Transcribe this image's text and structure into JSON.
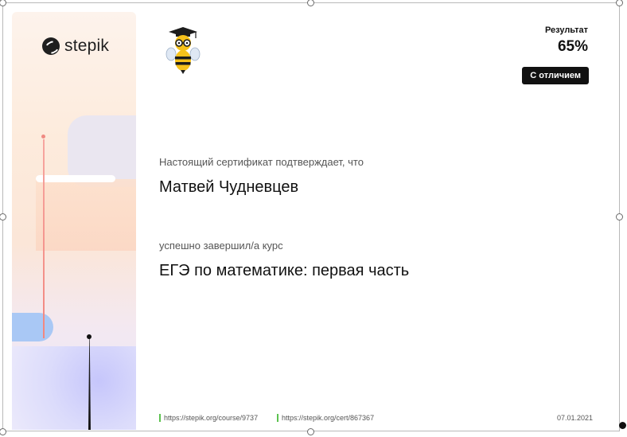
{
  "certificate": {
    "brand": "stepik",
    "result_label": "Результат",
    "result_value": "65%",
    "badge": "С отличием",
    "confirm_text": "Настоящий сертификат подтверждает, что",
    "recipient_name": "Матвей Чудневцев",
    "completed_text": "успешно завершил/а  курс",
    "course_title": "ЕГЭ по математике: первая часть",
    "course_link": "https://stepik.org/course/9737",
    "cert_link": "https://stepik.org/cert/867367",
    "date": "07.01.2021"
  },
  "colors": {
    "accent_dark": "#111111",
    "link_marker": "#5cc24f",
    "side_gradient_top": "#fdf3ec",
    "side_gradient_bottom": "#e7e7fb"
  },
  "icons": {
    "logo": "stepik-logo-icon",
    "mascot": "bee-mascot-icon"
  }
}
